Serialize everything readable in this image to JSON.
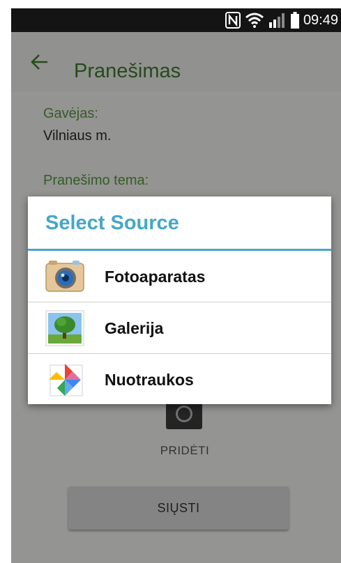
{
  "status_bar": {
    "time": "09:49",
    "icons": [
      "nfc-icon",
      "wifi-icon",
      "signal-icon",
      "battery-icon"
    ]
  },
  "header": {
    "title": "Pranešimas",
    "back_icon": "back-arrow-icon"
  },
  "form": {
    "recipient_label": "Gavėjas:",
    "recipient_value": "Vilniaus m.",
    "subject_label": "Pranešimo tema:",
    "add_label": "PRIDĖTI",
    "send_label": "SIŲSTI"
  },
  "dialog": {
    "title": "Select Source",
    "items": [
      {
        "label": "Fotoaparatas",
        "icon": "camera-app-icon"
      },
      {
        "label": "Galerija",
        "icon": "gallery-app-icon"
      },
      {
        "label": "Nuotraukos",
        "icon": "photos-app-icon"
      }
    ]
  },
  "colors": {
    "accent": "#45A7C9",
    "app_green": "#3E7D2A",
    "label_green": "#5A9A3E",
    "status_bar": "#141414"
  }
}
